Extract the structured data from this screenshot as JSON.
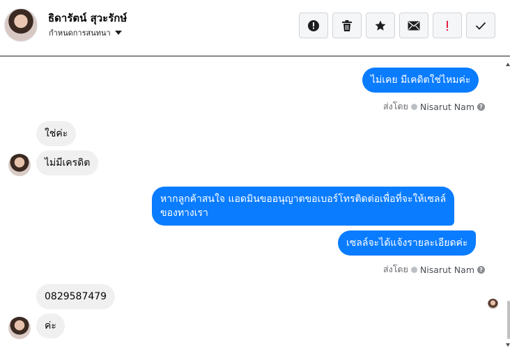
{
  "header": {
    "contact_name": "ธิดารัตน์ สุวะรักษ์",
    "conversation_menu_label": "กำหนดการสนทนา"
  },
  "toolbar": {
    "buttons": [
      {
        "icon": "alert-circle-icon"
      },
      {
        "icon": "trash-icon"
      },
      {
        "icon": "star-icon"
      },
      {
        "icon": "envelope-icon"
      },
      {
        "icon": "exclamation-icon",
        "color": "#e41e3f"
      },
      {
        "icon": "checkmark-icon"
      }
    ]
  },
  "messages": {
    "m1": "ไม่เคย มีเคดิตใช่ไหมค่ะ",
    "sent_by_1": {
      "prefix": "ส่งโดย",
      "agent": "Nisarut Nam"
    },
    "m2": "ใช่ค่ะ",
    "m3": "ไม่มีเครดิต",
    "m4_line1": "หากลูกค้าสนใจ แอดมินขออนุญาตขอเบอร์โทรติดต่อเพื่อที่จะให้เซลล์",
    "m4_line2": "ของทางเรา",
    "m5": "เซลล์จะได้แจ้งรายละเอียดค่ะ",
    "sent_by_2": {
      "prefix": "ส่งโดย",
      "agent": "Nisarut Nam"
    },
    "m6": "0829587479",
    "m7": "ค่ะ"
  },
  "colors": {
    "outgoing_bubble": "#0a7cff",
    "incoming_bubble": "#f0f0f0",
    "header_border": "#1c1e21"
  }
}
